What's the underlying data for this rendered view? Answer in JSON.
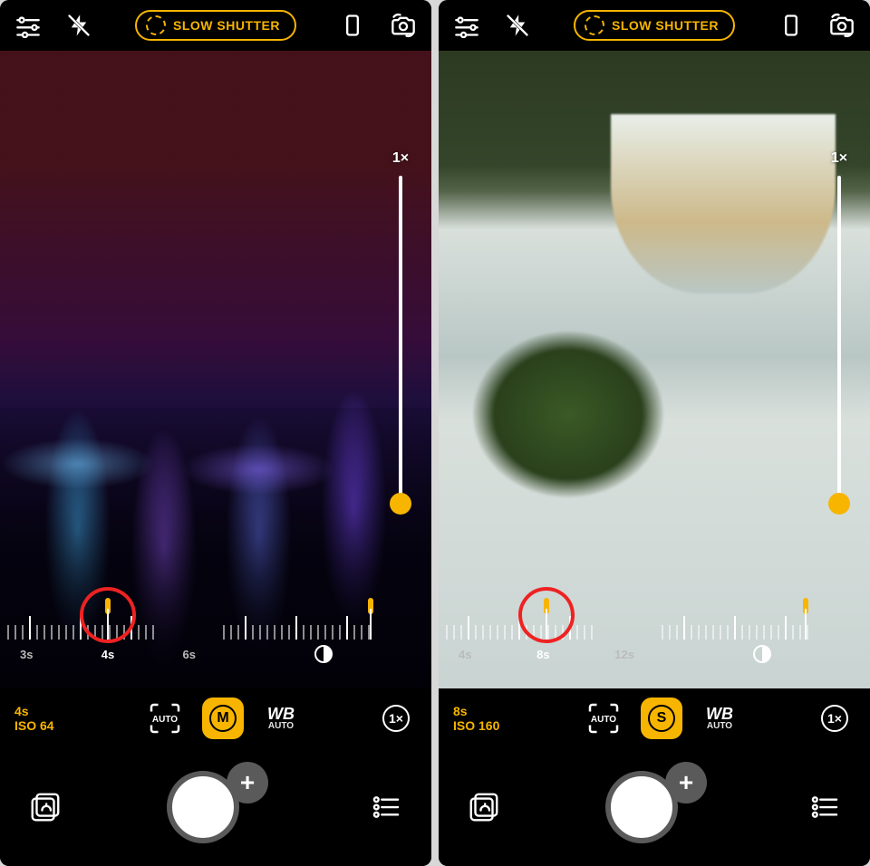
{
  "shots": [
    {
      "mode_label": "SLOW SHUTTER",
      "zoom_label": "1×",
      "zoom_knob_bottom": "0%",
      "shutter_dial": {
        "values": [
          "3s",
          "4s",
          "6s"
        ],
        "highlight_index": 1,
        "marker_pct": 50,
        "annotation_pct": 50
      },
      "ev_dial": {
        "marker_pct": 72
      },
      "readout": {
        "shutter": "4s",
        "iso": "ISO 64"
      },
      "mode_button": {
        "letter": "M"
      },
      "wb": {
        "label": "WB",
        "sub": "AUTO"
      },
      "zoom_button": "1×",
      "af_label": "AUTO",
      "shutter_plus": "+"
    },
    {
      "mode_label": "SLOW SHUTTER",
      "zoom_label": "1×",
      "zoom_knob_bottom": "0%",
      "shutter_dial": {
        "values": [
          "4s",
          "8s",
          "12s"
        ],
        "highlight_index": 1,
        "marker_pct": 50,
        "annotation_pct": 50
      },
      "ev_dial": {
        "marker_pct": 70
      },
      "readout": {
        "shutter": "8s",
        "iso": "ISO 160"
      },
      "mode_button": {
        "letter": "S"
      },
      "wb": {
        "label": "WB",
        "sub": "AUTO"
      },
      "zoom_button": "1×",
      "af_label": "AUTO",
      "shutter_plus": "+"
    }
  ]
}
